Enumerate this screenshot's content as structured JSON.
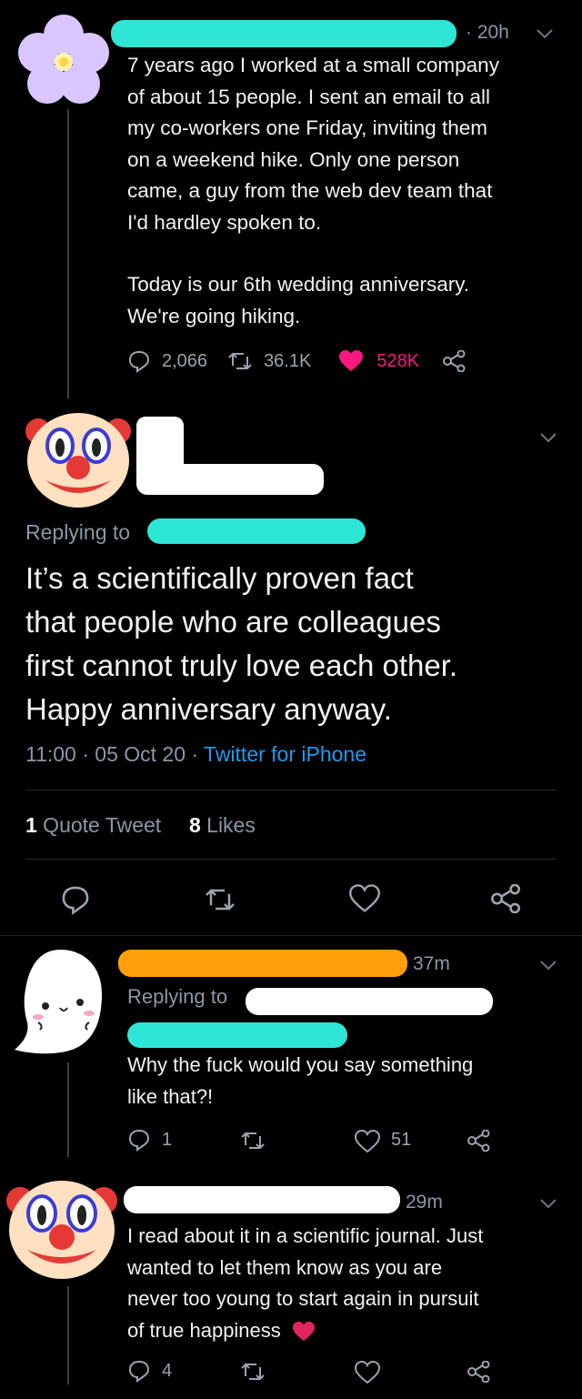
{
  "thread": {
    "tweet1": {
      "time": "· 20h",
      "text_lines": [
        "7 years ago I worked at a small company",
        "of about 15 people. I sent an email to all",
        "my co-workers one Friday, inviting them",
        "on a weekend hike. Only one person",
        "came, a guy from the web dev team that",
        "I'd hardley spoken to."
      ],
      "text_lines2": [
        "Today is our 6th wedding anniversary.",
        "We're going hiking."
      ],
      "replies": "2,066",
      "retweets": "36.1K",
      "likes": "528K",
      "like_color": "#f91880"
    },
    "main": {
      "replying_to": "Replying to",
      "text_lines": [
        "It’s a scientifically proven fact",
        "that people who are colleagues",
        "first cannot truly love each other.",
        "Happy anniversary anyway."
      ],
      "meta_time": "11:00 · 05 Oct 20 · ",
      "meta_source": "Twitter for iPhone",
      "quote_count": "1",
      "quote_label": " Quote Tweet",
      "likes_count": "8",
      "likes_label": " Likes"
    },
    "reply1": {
      "time": "37m",
      "replying_to": "Replying to",
      "text_lines": [
        "Why the fuck would you say something",
        "like that?!"
      ],
      "replies": "1",
      "likes": "51"
    },
    "reply2": {
      "time": "29m",
      "text_lines": [
        "I read about it in a scientific journal. Just",
        "wanted to let them know as you are",
        "never too young to start again in pursuit",
        "of true happiness"
      ],
      "replies": "4"
    }
  },
  "colors": {
    "background": "#000000",
    "link": "#1d9bf0",
    "redaction_cyan": "#2ee6d6",
    "redaction_orange": "#ff9f0a",
    "like_red": "#f91880"
  }
}
